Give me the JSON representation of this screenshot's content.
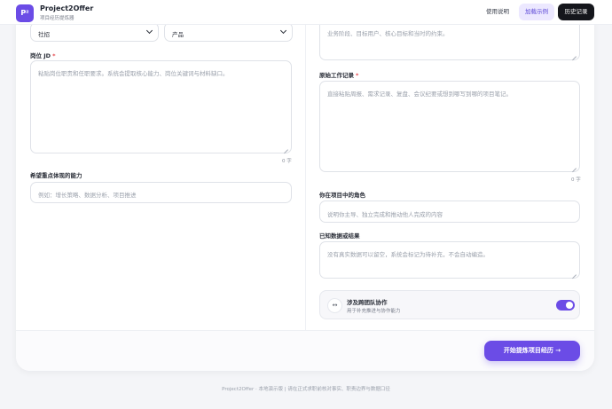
{
  "header": {
    "logo_text": "P²",
    "title": "Project2Offer",
    "subtitle": "项目经历提炼器",
    "help_label": "使用说明",
    "demo_label": "加载示例",
    "history_label": "历史记录"
  },
  "form_left": {
    "recruit_type_value": "社招",
    "role_type_value": "产品",
    "jd_label": "岗位 JD",
    "jd_required_mark": "*",
    "jd_placeholder": "粘贴岗位职责和任职要求。系统会提取核心能力、岗位关键词与材料缺口。",
    "jd_count": "0 字",
    "skills_label": "希望重点体现的能力",
    "skills_placeholder": "例如：增长策略、数据分析、项目推进"
  },
  "form_right": {
    "background_placeholder": "业务阶段、目标用户、核心目标和当时的约束。",
    "raw_label": "原始工作记录",
    "raw_required_mark": "*",
    "raw_placeholder": "直接粘贴周报、需求记录、复盘、会议纪要或想到哪写到哪的项目笔记。",
    "raw_count": "0 字",
    "role_label": "你在项目中的角色",
    "role_placeholder": "说明你主导、独立完成和推动他人完成的内容",
    "data_label": "已知数据或结果",
    "data_placeholder": "没有真实数据可以留空，系统会标记为待补充，不会自动编造。",
    "team_icon": "↔",
    "team_title": "涉及跨团队协作",
    "team_subtitle": "用于补充推进与协作能力",
    "team_enabled": true
  },
  "actions": {
    "submit_label": "开始提炼项目经历 →"
  },
  "footer": {
    "text": "Project2Offer · 本地演示版 | 请在正式求职前核对事实、职责边界与数据口径"
  }
}
